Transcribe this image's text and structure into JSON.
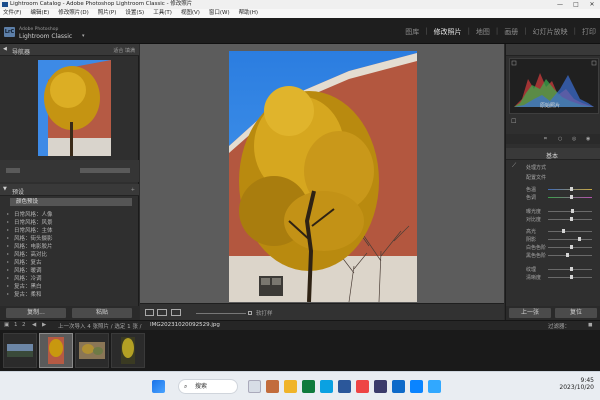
{
  "window": {
    "title": "Lightroom Catalog - Adobe Photoshop Lightroom Classic - 修改照片",
    "min": "—",
    "max": "□",
    "close": "✕"
  },
  "menu": [
    "文件(F)",
    "编辑(E)",
    "修改照片(D)",
    "照片(P)",
    "设置(S)",
    "工具(T)",
    "视图(V)",
    "窗口(W)",
    "帮助(H)"
  ],
  "identity": {
    "badge": "LrC",
    "brand_line1": "Adobe Photoshop",
    "brand_line2": "Lightroom Classic",
    "modules": [
      "图库",
      "修改照片",
      "地图",
      "画册",
      "幻灯片放映",
      "打印"
    ],
    "active_module": "修改照片"
  },
  "left": {
    "navigator_title": "导航器",
    "navigator_zoom": "适合 填满",
    "presets_title": "预设",
    "preset_group": "颜色预设",
    "preset_items": [
      "日常风格：人像",
      "日常风格：风景",
      "日常风格：主体",
      "风格：街头摄影",
      "风格：电影胶片",
      "风格：高对比",
      "风格：复古",
      "风格：暖调",
      "风格：冷调",
      "复古：黑白",
      "复古：柔和"
    ],
    "copy_button": "复制...",
    "paste_button": "粘贴"
  },
  "toolbar": {
    "softproof_label": "软打样"
  },
  "right": {
    "histogram_label": "原始照片",
    "panel_title": "基本",
    "labels": [
      "处理方式",
      "配置文件",
      "色温",
      "色调",
      "曝光度",
      "对比度",
      "高光",
      "阴影",
      "白色色阶",
      "黑色色阶",
      "纹理",
      "清晰度"
    ],
    "prev_button": "上一张",
    "reset_button": "复位"
  },
  "filmstrip": {
    "page_left": "1",
    "page_right": "2",
    "info": "上一次导入 4 张照片 / 选定 1 张 /",
    "filename": "IMG20231020092529.jpg",
    "filter_label": "过滤器："
  },
  "taskbar": {
    "search_text": "搜索",
    "time": "9:45",
    "date": "2023/10/20"
  },
  "colors": {
    "accent_sky": "#2f7fe0",
    "accent_foliage": "#d3a21a",
    "wall_orange": "#b55a44"
  }
}
